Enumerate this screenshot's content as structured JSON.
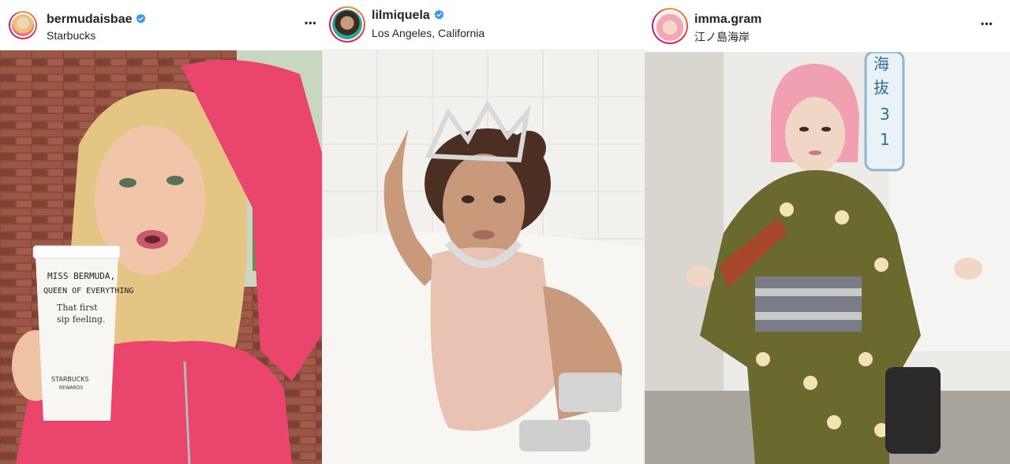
{
  "posts": [
    {
      "username": "bermudaisbae",
      "location": "Starbucks",
      "verified": true,
      "cup_text": {
        "line1": "MISS BERMUDA,",
        "line2": "QUEEN OF EVERYTHING",
        "line3": "That first",
        "line4": "sip feeling.",
        "brand": "STARBUCKS",
        "sub": "REWARDS"
      }
    },
    {
      "username": "lilmiquela",
      "location": "Los Angeles, California",
      "verified": true
    },
    {
      "username": "imma.gram",
      "location": "江ノ島海岸",
      "verified": false,
      "sign_text": {
        "c1": "海",
        "c2": "抜",
        "c3": "3",
        "c4": "1"
      }
    }
  ],
  "icons": {
    "more": "more-options-icon",
    "verified": "verified-badge-icon"
  },
  "colors": {
    "verified_blue": "#3897f0",
    "ring_start": "#f09433",
    "ring_end": "#bc1888"
  },
  "more_label": "•••"
}
